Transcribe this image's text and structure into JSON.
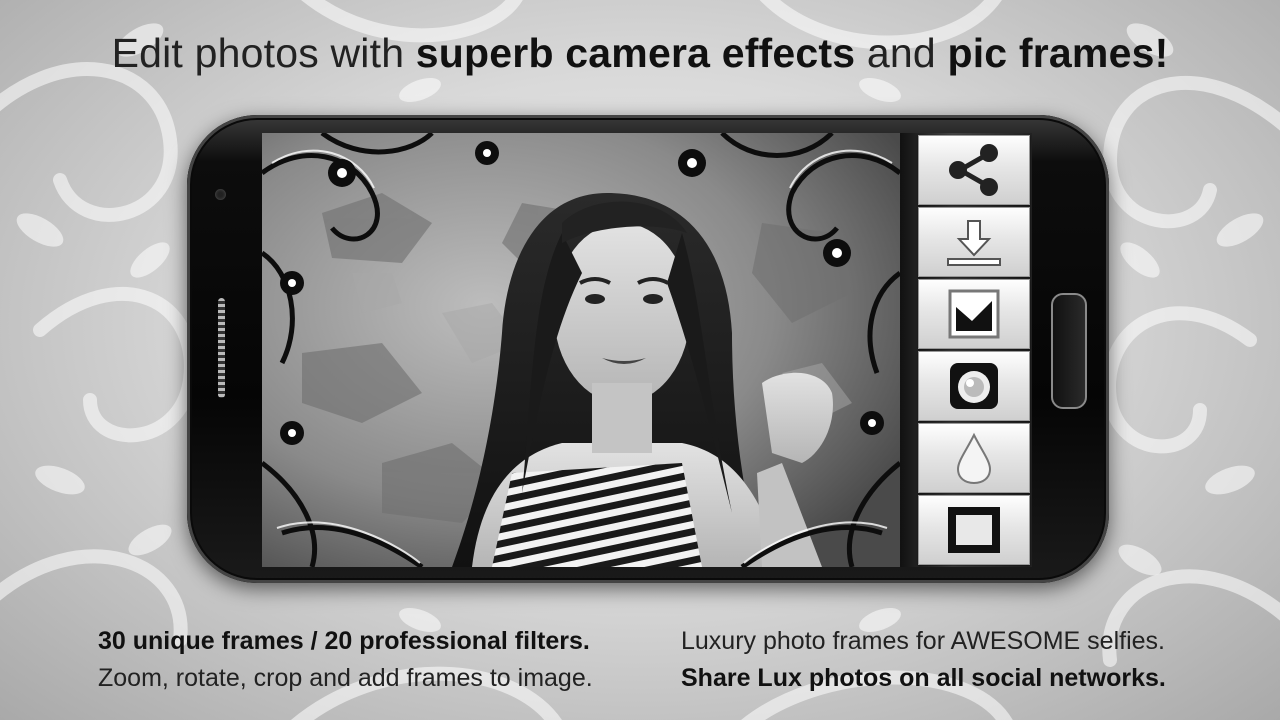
{
  "headline": {
    "part1": "Edit photos with ",
    "part2": "superb camera effects",
    "part3": " and ",
    "part4": "pic frames!"
  },
  "features": {
    "line1": "30 unique frames / 20 professional filters.",
    "line2": "Zoom, rotate, crop and add frames to image.",
    "line3": "Luxury photo frames for AWESOME selfies.",
    "line4": "Share Lux photos on all social networks."
  },
  "toolbar": {
    "buttons": [
      {
        "icon": "share-icon"
      },
      {
        "icon": "download-icon"
      },
      {
        "icon": "frames-gallery-icon"
      },
      {
        "icon": "camera-effects-icon"
      },
      {
        "icon": "drop-icon"
      },
      {
        "icon": "frame-icon"
      }
    ]
  },
  "colors": {
    "background": "#d9d9d9",
    "phone_body": "#0d0d0d",
    "text": "#111111",
    "button_face": "#e6e6e6"
  }
}
